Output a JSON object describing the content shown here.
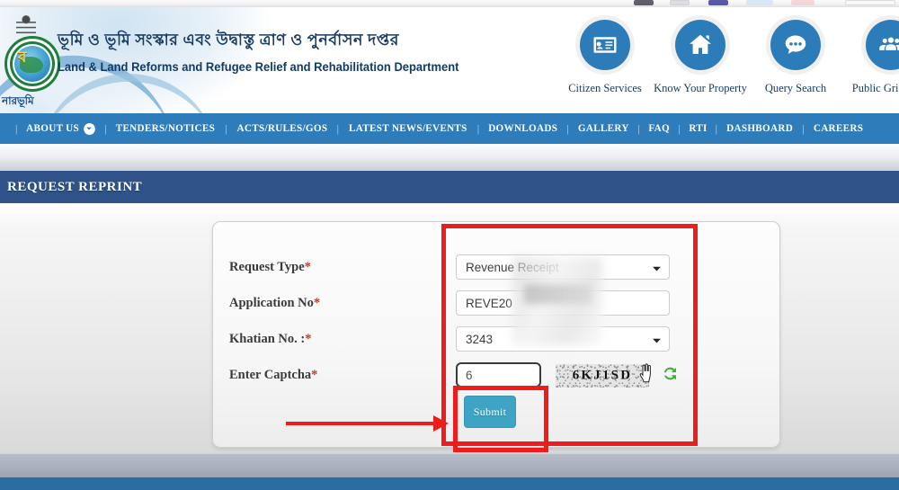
{
  "site": {
    "logo_glyph": "ব",
    "logo_footer_bn": "নারভূমি",
    "title_bn": "ভূমি ও ভূমি সংস্কার এবং উদ্বাস্তু ত্রাণ ও পুনর্বাসন দপ্তর",
    "title_en": "Land & Land Reforms and Refugee Relief and Rehabilitation Department"
  },
  "quicklinks": [
    {
      "label": "Citizen Services",
      "icon": "id-card-icon"
    },
    {
      "label": "Know Your Property",
      "icon": "home-icon"
    },
    {
      "label": "Query Search",
      "icon": "chat-bubble-icon"
    },
    {
      "label": "Public Grievance",
      "icon": "people-group-icon"
    }
  ],
  "nav": {
    "separator": "|",
    "items": [
      {
        "label": "ABOUT US",
        "has_dropdown": true
      },
      {
        "label": "TENDERS/NOTICES",
        "has_dropdown": false
      },
      {
        "label": "ACTS/RULES/GOS",
        "has_dropdown": false
      },
      {
        "label": "LATEST NEWS/EVENTS",
        "has_dropdown": false
      },
      {
        "label": "DOWNLOADS",
        "has_dropdown": false
      },
      {
        "label": "GALLERY",
        "has_dropdown": false
      },
      {
        "label": "FAQ",
        "has_dropdown": false
      },
      {
        "label": "RTI",
        "has_dropdown": false
      },
      {
        "label": "DASHBOARD",
        "has_dropdown": false
      },
      {
        "label": "CAREERS",
        "has_dropdown": false
      }
    ]
  },
  "page": {
    "title": "REQUEST REPRINT"
  },
  "form": {
    "rows": [
      {
        "label": "Request Type",
        "required_mark": "*",
        "control": "select",
        "value": "Revenue Receipt"
      },
      {
        "label": "Application No",
        "required_mark": "*",
        "control": "text",
        "value": "REVE20",
        "placeholder": ""
      },
      {
        "label": "Khatian No. :",
        "required_mark": "*",
        "control": "select",
        "value": "3243"
      },
      {
        "label": "Enter Captcha",
        "required_mark": "*",
        "control": "captcha",
        "value": "6",
        "placeholder": ""
      }
    ],
    "captcha_text": "6KJ1SD",
    "refresh_icon": "refresh-captcha-icon",
    "submit_label": "Submit"
  },
  "colors": {
    "nav_blue": "#2e7cba",
    "title_band_blue": "#2f5289",
    "icon_circle_blue": "#2d7cba",
    "submit_teal": "#3fa3c4",
    "annotation_red": "#ee1c1c",
    "refresh_green": "#35b42c",
    "footer_blue": "#2b6ca3"
  }
}
